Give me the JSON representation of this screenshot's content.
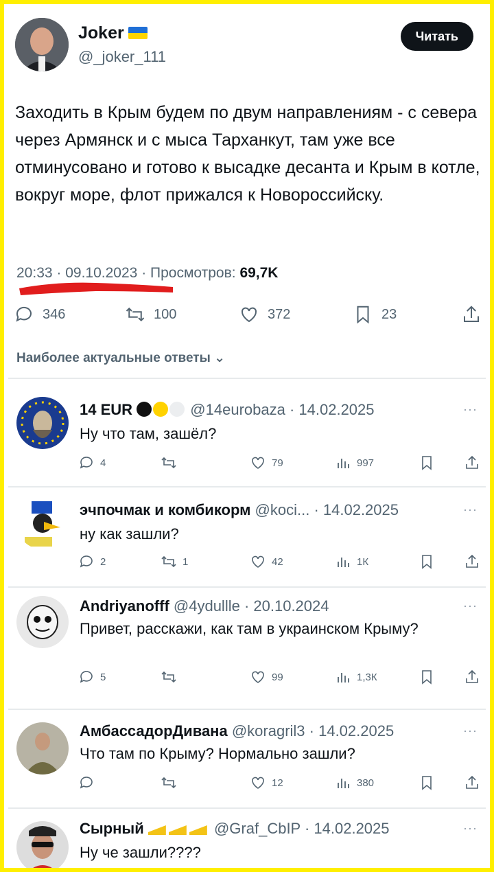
{
  "tweet": {
    "author_name": "Joker",
    "author_handle": "@_joker_111",
    "read_button": "Читать",
    "text": "Заходить в Крым будем по двум направлениям - с севера через Армянск и с мыса Тарханкут, там уже все отминусовано и готово к высадке десанта и Крым в котле, вокруг море, флот прижался к Новороссийску.",
    "time": "20:33",
    "date": "09.10.2023",
    "views_label": "Просмотров:",
    "views": "69,7K",
    "replies": "346",
    "retweets": "100",
    "likes": "372",
    "bookmarks": "23"
  },
  "best_answers_label": "Наиболее актуальные ответы",
  "replies": [
    {
      "name": "14 EUR",
      "handle": "@14eurobaza",
      "date": "14.02.2025",
      "text": "Ну что там, зашёл?",
      "replies": "4",
      "retweets": "",
      "likes": "79",
      "views": "997"
    },
    {
      "name": "эчпочмак и комбикорм",
      "handle": "@koci...",
      "date": "14.02.2025",
      "text": "ну как зашли?",
      "replies": "2",
      "retweets": "1",
      "likes": "42",
      "views": "1К"
    },
    {
      "name": "Andriyanofff",
      "handle": "@4ydullle",
      "date": "20.10.2024",
      "text": "Привет, расскажи, как там в украинском Крыму?",
      "replies": "5",
      "retweets": "",
      "likes": "99",
      "views": "1,3К"
    },
    {
      "name": "АмбассадорДивана",
      "handle": "@koragril3",
      "date": "14.02.2025",
      "text": "Что там по Крыму? Нормально зашли?",
      "replies": "",
      "retweets": "",
      "likes": "12",
      "views": "380"
    },
    {
      "name": "Сырный",
      "handle": "@Graf_CbIP",
      "date": "14.02.2025",
      "text": "Ну че зашли????",
      "replies": "",
      "retweets": "",
      "likes": "",
      "views": ""
    }
  ],
  "colors": {
    "frame": "#ffef00",
    "text": "#0f1419",
    "muted": "#536471",
    "underline": "#e11d1d"
  },
  "icons": [
    "reply-icon",
    "retweet-icon",
    "like-icon",
    "views-icon",
    "bookmark-icon",
    "share-icon",
    "more-icon"
  ]
}
